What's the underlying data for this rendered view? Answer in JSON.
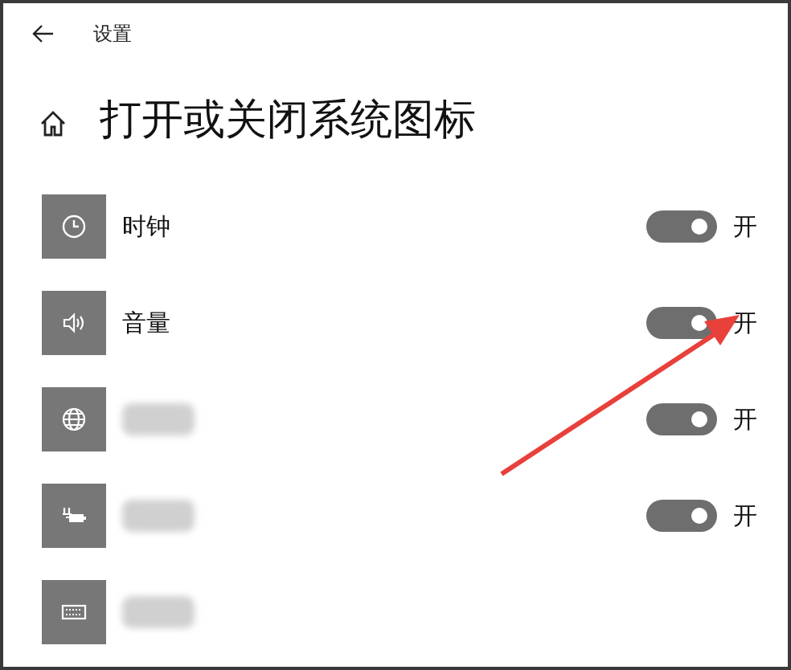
{
  "window": {
    "title": "设置"
  },
  "page": {
    "heading": "打开或关闭系统图标"
  },
  "rows": [
    {
      "label": "时钟",
      "redacted": false,
      "toggle": {
        "on": true,
        "state_label": "开"
      }
    },
    {
      "label": "音量",
      "redacted": false,
      "toggle": {
        "on": true,
        "state_label": "开"
      }
    },
    {
      "redacted": true,
      "toggle": {
        "on": true,
        "state_label": "开"
      }
    },
    {
      "redacted": true,
      "toggle": {
        "on": true,
        "state_label": "开"
      }
    },
    {
      "redacted": true
    }
  ],
  "annotation": {
    "kind": "arrow",
    "color": "#e8403a"
  }
}
